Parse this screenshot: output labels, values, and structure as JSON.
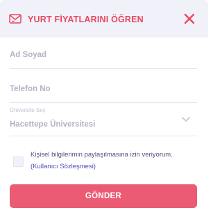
{
  "header": {
    "title": "YURT FİYATLARINI ÖĞREN",
    "icon": "envelope-icon",
    "close_icon": "close-icon"
  },
  "form": {
    "name_placeholder": "Ad Soyad",
    "phone_placeholder": "Telefon No",
    "university_label": "Üniversite Seç",
    "university_value": "Hacettepe Üniversitesi",
    "consent_text": "Kişisel bilgilerimin paylaşılmasına izin veriyorum.",
    "consent_link": "(Kullanıcı Sözleşmesi)",
    "consent_checked": false,
    "submit_label": "GÖNDER"
  },
  "colors": {
    "accent": "#e8485f",
    "button": "#eb5b73",
    "header_bg": "#f1f1fa",
    "link": "#4b4bbf"
  }
}
